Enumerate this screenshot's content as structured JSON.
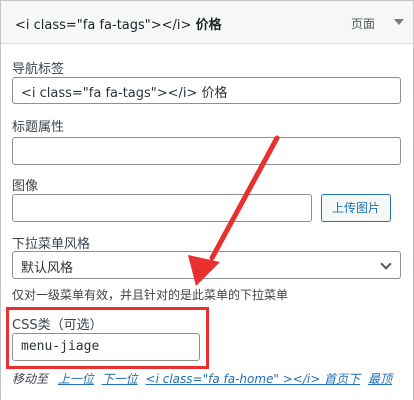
{
  "item": {
    "title_code": "<i class=\"fa fa-tags\"></i>",
    "title_text": "价格",
    "type_label": "页面"
  },
  "fields": {
    "nav_label": {
      "label": "导航标签",
      "value": "<i class=\"fa fa-tags\"></i> 价格"
    },
    "title_attr": {
      "label": "标题属性",
      "value": ""
    },
    "image": {
      "label": "图像",
      "value": "",
      "button": "上传图片"
    },
    "dropdown_style": {
      "label": "下拉菜单风格",
      "selected": "默认风格",
      "hint": "仅对一级菜单有效，并且针对的是此菜单的下拉菜单"
    },
    "css_class": {
      "label": "CSS类（可选）",
      "value": "menu-jiage"
    }
  },
  "move": {
    "label": "移动至",
    "up": "上一位",
    "down": "下一位",
    "under": "<i class=\"fa fa-home\" ></i> 首页下",
    "top": "最顶"
  },
  "colors": {
    "highlight": "#e8302f",
    "link": "#2271b1"
  }
}
